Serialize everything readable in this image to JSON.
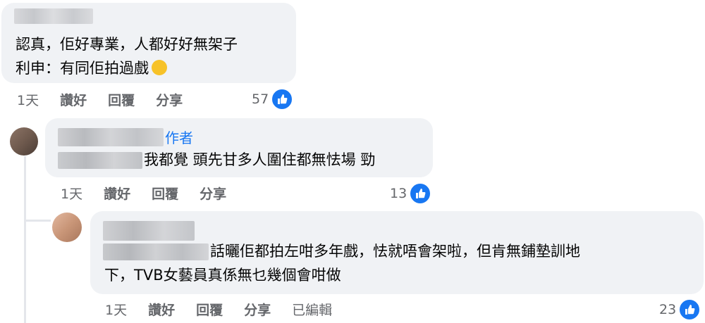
{
  "comments": [
    {
      "text_line1": "認真，佢好專業，人都好好無架子",
      "text_line2": "利申：有同佢拍過戲",
      "emoji": "upside-down-face-emoji",
      "time": "1天",
      "like_label": "讚好",
      "reply_label": "回覆",
      "share_label": "分享",
      "like_count": "57"
    },
    {
      "author_badge": "作者",
      "text": "我都覺 頭先甘多人圍住都無怯場 勁",
      "time": "1天",
      "like_label": "讚好",
      "reply_label": "回覆",
      "share_label": "分享",
      "like_count": "13"
    },
    {
      "text_line1": "話曬佢都拍左咁多年戲，怯就唔會架啦，但肯無鋪墊訓地",
      "text_line2": "下，TVB女藝員真係無乜幾個會咁做",
      "time": "1天",
      "like_label": "讚好",
      "reply_label": "回覆",
      "share_label": "分享",
      "edited_label": "已編輯",
      "like_count": "23"
    }
  ],
  "colors": {
    "bubble": "#f0f2f5",
    "like_blue": "#1877f2",
    "meta_gray": "#65676b"
  }
}
